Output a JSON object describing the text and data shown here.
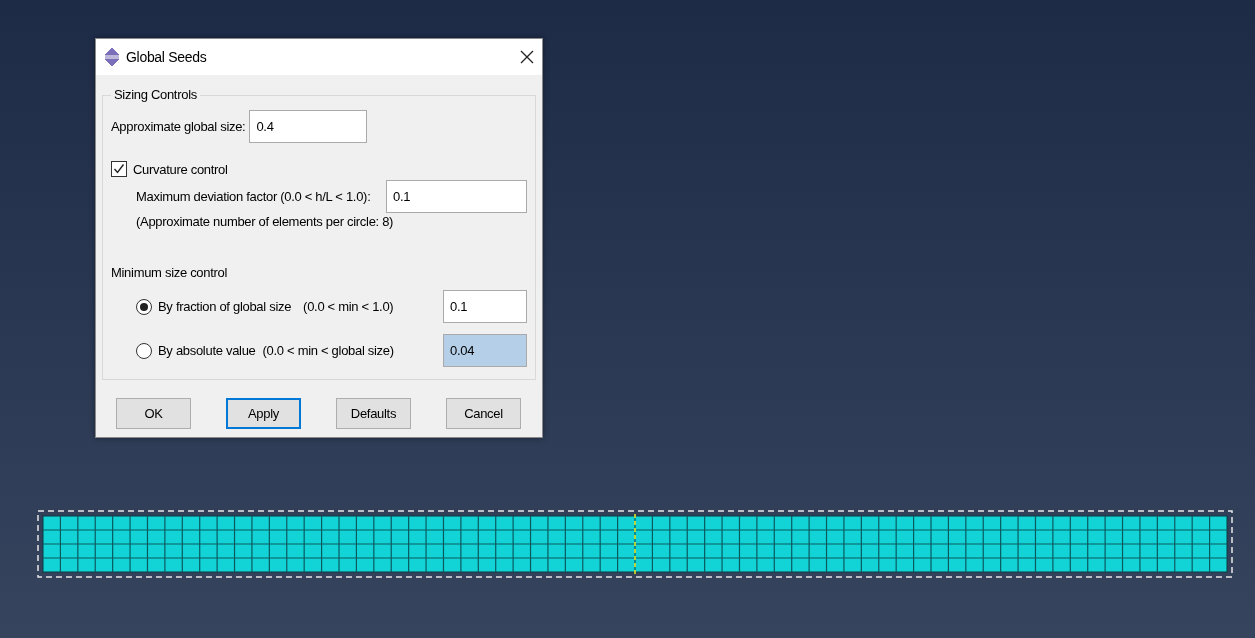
{
  "dialog": {
    "title": "Global Seeds",
    "group_title": "Sizing Controls",
    "global_size": {
      "label": "Approximate global size:",
      "value": "0.4"
    },
    "curvature": {
      "label": "Curvature control",
      "checked": true,
      "deviation_label": "Maximum deviation factor (0.0 < h/L < 1.0):",
      "deviation_value": "0.1",
      "note": "(Approximate number of elements per circle: 8)"
    },
    "minimum_size": {
      "label": "Minimum size control",
      "options": [
        {
          "label": "By fraction of global size",
          "range": "(0.0 < min < 1.0)",
          "value": "0.1",
          "selected": true
        },
        {
          "label": "By absolute value",
          "range": "(0.0 < min < global size)",
          "value": "0.04",
          "selected": false
        }
      ]
    },
    "buttons": [
      {
        "label": "OK",
        "focused": false
      },
      {
        "label": "Apply",
        "focused": true
      },
      {
        "label": "Defaults",
        "focused": false
      },
      {
        "label": "Cancel",
        "focused": false
      }
    ]
  }
}
